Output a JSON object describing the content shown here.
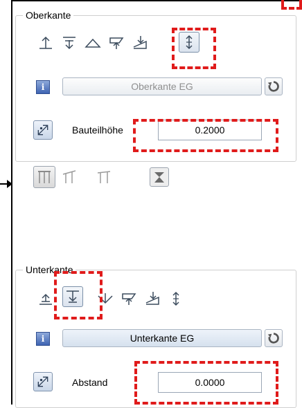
{
  "oberkante": {
    "group_title": "Oberkante",
    "icons": [
      "top-edge-upward-icon",
      "top-edge-downward-icon",
      "triangle-icon",
      "plane-downward-icon",
      "slanted-plane-icon",
      "vertical-dimension-icon"
    ],
    "reference_button": "Oberkante EG",
    "height_label": "Bauteilhöhe",
    "height_value": "0.2000",
    "profile_icons": [
      "profile-parallel-icon",
      "profile-sloped-icon",
      "profile-table-icon",
      "cone-shape-icon"
    ]
  },
  "unterkante": {
    "group_title": "Unterkante",
    "icons": [
      "bottom-edge-upward-icon",
      "bottom-edge-downward-icon",
      "funnel-downward-icon",
      "plane-downward-icon",
      "slanted-plane-icon",
      "vertical-dimension-icon"
    ],
    "reference_button": "Unterkante EG",
    "distance_label": "Abstand",
    "distance_value": "0.0000"
  },
  "colors": {
    "highlight": "#e01b1b",
    "icon_stroke": "#3a4a5c",
    "info_blue": "#3f64b3"
  }
}
